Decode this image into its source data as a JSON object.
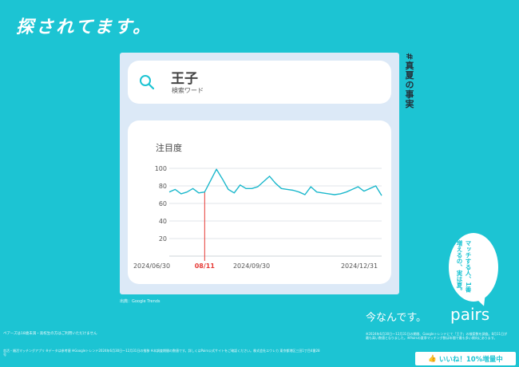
{
  "headline": "探されてます。",
  "hashtag": "#真夏の事実",
  "search": {
    "keyword": "王子",
    "sublabel": "検索ワード"
  },
  "source": "出典：Google Trends",
  "bubble_text": "マッチする人、1番増えるの、実は夏。",
  "tagline": "今なんです。",
  "brand": "pairs",
  "badge": "いいね！10%増量中",
  "notes": {
    "right": "※2024年6月30日〜12月31日の期間、Googleトレンドにて「王子」の検索数を調査。8月11日が最も高い数値となりました。※Pairsの夏季マッチング数は年間で最も多い傾向にあります。",
    "left1": "ペアーズは18歳未満・高校生の方はご利用いただけません",
    "left2": "恋活・婚活マッチングアプリ ※データは参考値 ※Googleトレンド2024年6月30日〜12月31日の推移 ※本調査期間の数値です。詳しくはPairs公式サイトをご確認ください。株式会社エウレカ 東京都港区三田1丁目4番28号"
  },
  "chart_data": {
    "type": "line",
    "title": "注目度",
    "yticks": [
      100,
      80,
      60,
      40,
      20
    ],
    "ylim": [
      0,
      100
    ],
    "xticks": [
      "2024/06/30",
      "08/11",
      "2024/09/30",
      "2024/12/31"
    ],
    "highlight": {
      "label": "08/11",
      "x": 6,
      "color": "#e53935"
    },
    "series": [
      {
        "color": "#1cb8cc",
        "values": [
          73,
          76,
          71,
          73,
          77,
          72,
          73,
          86,
          99,
          88,
          76,
          72,
          81,
          77,
          77,
          79,
          85,
          91,
          83,
          77,
          76,
          75,
          73,
          70,
          79,
          73,
          72,
          71,
          70,
          71,
          73,
          76,
          79,
          74,
          77,
          80,
          69
        ]
      }
    ]
  }
}
